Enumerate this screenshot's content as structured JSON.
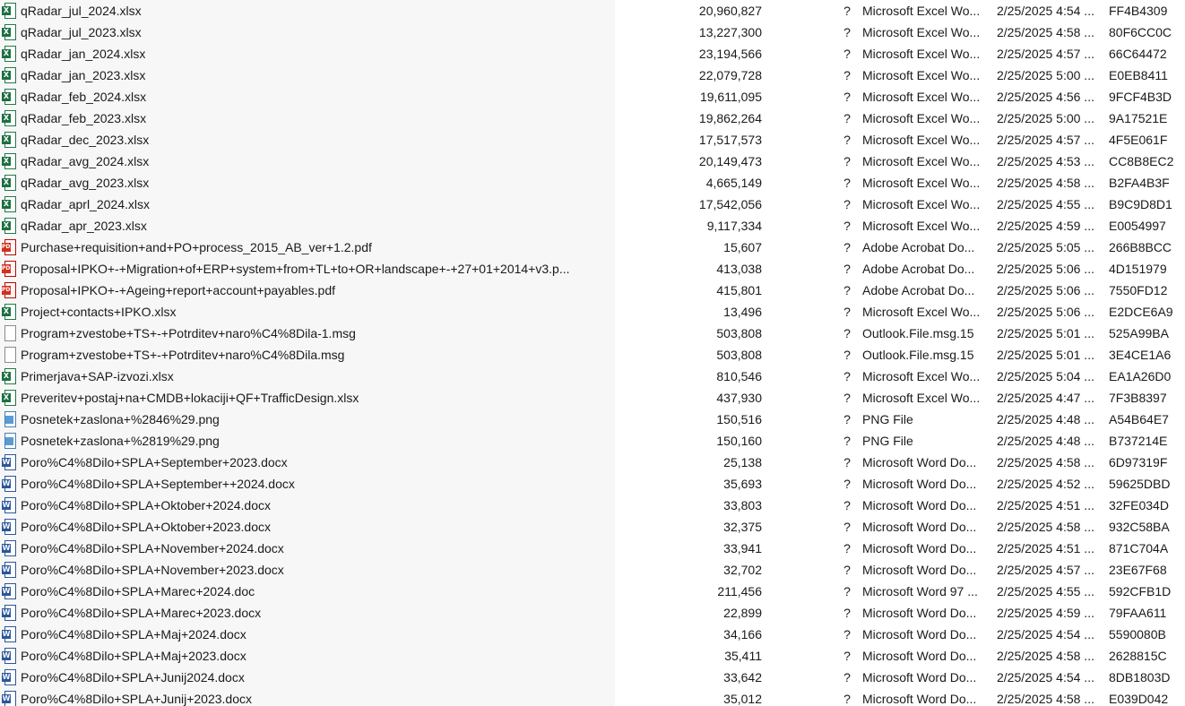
{
  "files": [
    {
      "icon": "excel-icon",
      "name": "qRadar_jul_2024.xlsx",
      "size": "20,960,827",
      "status": "?",
      "type": "Microsoft Excel Wo...",
      "modified": "2/25/2025 4:54 ...",
      "hash": "FF4B4309"
    },
    {
      "icon": "excel-icon",
      "name": "qRadar_jul_2023.xlsx",
      "size": "13,227,300",
      "status": "?",
      "type": "Microsoft Excel Wo...",
      "modified": "2/25/2025 4:58 ...",
      "hash": "80F6CC0C"
    },
    {
      "icon": "excel-icon",
      "name": "qRadar_jan_2024.xlsx",
      "size": "23,194,566",
      "status": "?",
      "type": "Microsoft Excel Wo...",
      "modified": "2/25/2025 4:57 ...",
      "hash": "66C64472"
    },
    {
      "icon": "excel-icon",
      "name": "qRadar_jan_2023.xlsx",
      "size": "22,079,728",
      "status": "?",
      "type": "Microsoft Excel Wo...",
      "modified": "2/25/2025 5:00 ...",
      "hash": "E0EB8411"
    },
    {
      "icon": "excel-icon",
      "name": "qRadar_feb_2024.xlsx",
      "size": "19,611,095",
      "status": "?",
      "type": "Microsoft Excel Wo...",
      "modified": "2/25/2025 4:56 ...",
      "hash": "9FCF4B3D"
    },
    {
      "icon": "excel-icon",
      "name": "qRadar_feb_2023.xlsx",
      "size": "19,862,264",
      "status": "?",
      "type": "Microsoft Excel Wo...",
      "modified": "2/25/2025 5:00 ...",
      "hash": "9A17521E"
    },
    {
      "icon": "excel-icon",
      "name": "qRadar_dec_2023.xlsx",
      "size": "17,517,573",
      "status": "?",
      "type": "Microsoft Excel Wo...",
      "modified": "2/25/2025 4:57 ...",
      "hash": "4F5E061F"
    },
    {
      "icon": "excel-icon",
      "name": "qRadar_avg_2024.xlsx",
      "size": "20,149,473",
      "status": "?",
      "type": "Microsoft Excel Wo...",
      "modified": "2/25/2025 4:53 ...",
      "hash": "CC8B8EC2"
    },
    {
      "icon": "excel-icon",
      "name": "qRadar_avg_2023.xlsx",
      "size": "4,665,149",
      "status": "?",
      "type": "Microsoft Excel Wo...",
      "modified": "2/25/2025 4:58 ...",
      "hash": "B2FA4B3F"
    },
    {
      "icon": "excel-icon",
      "name": "qRadar_aprl_2024.xlsx",
      "size": "17,542,056",
      "status": "?",
      "type": "Microsoft Excel Wo...",
      "modified": "2/25/2025 4:55 ...",
      "hash": "B9C9D8D1"
    },
    {
      "icon": "excel-icon",
      "name": "qRadar_apr_2023.xlsx",
      "size": "9,117,334",
      "status": "?",
      "type": "Microsoft Excel Wo...",
      "modified": "2/25/2025 4:59 ...",
      "hash": "E0054997"
    },
    {
      "icon": "pdf-icon",
      "name": "Purchase+requisition+and+PO+process_2015_AB_ver+1.2.pdf",
      "size": "15,607",
      "status": "?",
      "type": "Adobe Acrobat Do...",
      "modified": "2/25/2025 5:05 ...",
      "hash": "266B8BCC"
    },
    {
      "icon": "pdf-icon",
      "name": "Proposal+IPKO+-+Migration+of+ERP+system+from+TL+to+OR+landscape+-+27+01+2014+v3.p...",
      "size": "413,038",
      "status": "?",
      "type": "Adobe Acrobat Do...",
      "modified": "2/25/2025 5:06 ...",
      "hash": "4D151979"
    },
    {
      "icon": "pdf-icon",
      "name": "Proposal+IPKO+-+Ageing+report+account+payables.pdf",
      "size": "415,801",
      "status": "?",
      "type": "Adobe Acrobat Do...",
      "modified": "2/25/2025 5:06 ...",
      "hash": "7550FD12"
    },
    {
      "icon": "excel-icon",
      "name": "Project+contacts+IPKO.xlsx",
      "size": "13,496",
      "status": "?",
      "type": "Microsoft Excel Wo...",
      "modified": "2/25/2025 5:06 ...",
      "hash": "E2DCE6A9"
    },
    {
      "icon": "msg-icon",
      "name": "Program+zvestobe+TS+-+Potrditev+naro%C4%8Dila-1.msg",
      "size": "503,808",
      "status": "?",
      "type": "Outlook.File.msg.15",
      "modified": "2/25/2025 5:01 ...",
      "hash": "525A99BA"
    },
    {
      "icon": "msg-icon",
      "name": "Program+zvestobe+TS+-+Potrditev+naro%C4%8Dila.msg",
      "size": "503,808",
      "status": "?",
      "type": "Outlook.File.msg.15",
      "modified": "2/25/2025 5:01 ...",
      "hash": "3E4CE1A6"
    },
    {
      "icon": "excel-icon",
      "name": "Primerjava+SAP-izvozi.xlsx",
      "size": "810,546",
      "status": "?",
      "type": "Microsoft Excel Wo...",
      "modified": "2/25/2025 5:04 ...",
      "hash": "EA1A26D0"
    },
    {
      "icon": "excel-icon",
      "name": "Preveritev+postaj+na+CMDB+lokaciji+QF+TrafficDesign.xlsx",
      "size": "437,930",
      "status": "?",
      "type": "Microsoft Excel Wo...",
      "modified": "2/25/2025 4:47 ...",
      "hash": "7F3B8397"
    },
    {
      "icon": "png-icon",
      "name": "Posnetek+zaslona+%2846%29.png",
      "size": "150,516",
      "status": "?",
      "type": "PNG File",
      "modified": "2/25/2025 4:48 ...",
      "hash": "A54B64E7"
    },
    {
      "icon": "png-icon",
      "name": "Posnetek+zaslona+%2819%29.png",
      "size": "150,160",
      "status": "?",
      "type": "PNG File",
      "modified": "2/25/2025 4:48 ...",
      "hash": "B737214E"
    },
    {
      "icon": "word-icon",
      "name": "Poro%C4%8Dilo+SPLA+September+2023.docx",
      "size": "25,138",
      "status": "?",
      "type": "Microsoft Word Do...",
      "modified": "2/25/2025 4:58 ...",
      "hash": "6D97319F"
    },
    {
      "icon": "word-icon",
      "name": "Poro%C4%8Dilo+SPLA+September++2024.docx",
      "size": "35,693",
      "status": "?",
      "type": "Microsoft Word Do...",
      "modified": "2/25/2025 4:52 ...",
      "hash": "59625DBD"
    },
    {
      "icon": "word-icon",
      "name": "Poro%C4%8Dilo+SPLA+Oktober+2024.docx",
      "size": "33,803",
      "status": "?",
      "type": "Microsoft Word Do...",
      "modified": "2/25/2025 4:51 ...",
      "hash": "32FE034D"
    },
    {
      "icon": "word-icon",
      "name": "Poro%C4%8Dilo+SPLA+Oktober+2023.docx",
      "size": "32,375",
      "status": "?",
      "type": "Microsoft Word Do...",
      "modified": "2/25/2025 4:58 ...",
      "hash": "932C58BA"
    },
    {
      "icon": "word-icon",
      "name": "Poro%C4%8Dilo+SPLA+November+2024.docx",
      "size": "33,941",
      "status": "?",
      "type": "Microsoft Word Do...",
      "modified": "2/25/2025 4:51 ...",
      "hash": "871C704A"
    },
    {
      "icon": "word-icon",
      "name": "Poro%C4%8Dilo+SPLA+November+2023.docx",
      "size": "32,702",
      "status": "?",
      "type": "Microsoft Word Do...",
      "modified": "2/25/2025 4:57 ...",
      "hash": "23E67F68"
    },
    {
      "icon": "word-icon",
      "name": "Poro%C4%8Dilo+SPLA+Marec+2024.doc",
      "size": "211,456",
      "status": "?",
      "type": "Microsoft Word 97 ...",
      "modified": "2/25/2025 4:55 ...",
      "hash": "592CFB1D"
    },
    {
      "icon": "word-icon",
      "name": "Poro%C4%8Dilo+SPLA+Marec+2023.docx",
      "size": "22,899",
      "status": "?",
      "type": "Microsoft Word Do...",
      "modified": "2/25/2025 4:59 ...",
      "hash": "79FAA611"
    },
    {
      "icon": "word-icon",
      "name": "Poro%C4%8Dilo+SPLA+Maj+2024.docx",
      "size": "34,166",
      "status": "?",
      "type": "Microsoft Word Do...",
      "modified": "2/25/2025 4:54 ...",
      "hash": "5590080B"
    },
    {
      "icon": "word-icon",
      "name": "Poro%C4%8Dilo+SPLA+Maj+2023.docx",
      "size": "35,411",
      "status": "?",
      "type": "Microsoft Word Do...",
      "modified": "2/25/2025 4:58 ...",
      "hash": "2628815C"
    },
    {
      "icon": "word-icon",
      "name": "Poro%C4%8Dilo+SPLA+Junij2024.docx",
      "size": "33,642",
      "status": "?",
      "type": "Microsoft Word Do...",
      "modified": "2/25/2025 4:54 ...",
      "hash": "8DB1803D"
    },
    {
      "icon": "word-icon",
      "name": "Poro%C4%8Dilo+SPLA+Junij+2023.docx",
      "size": "35,012",
      "status": "?",
      "type": "Microsoft Word Do...",
      "modified": "2/25/2025 4:58 ...",
      "hash": "E039D042"
    }
  ]
}
